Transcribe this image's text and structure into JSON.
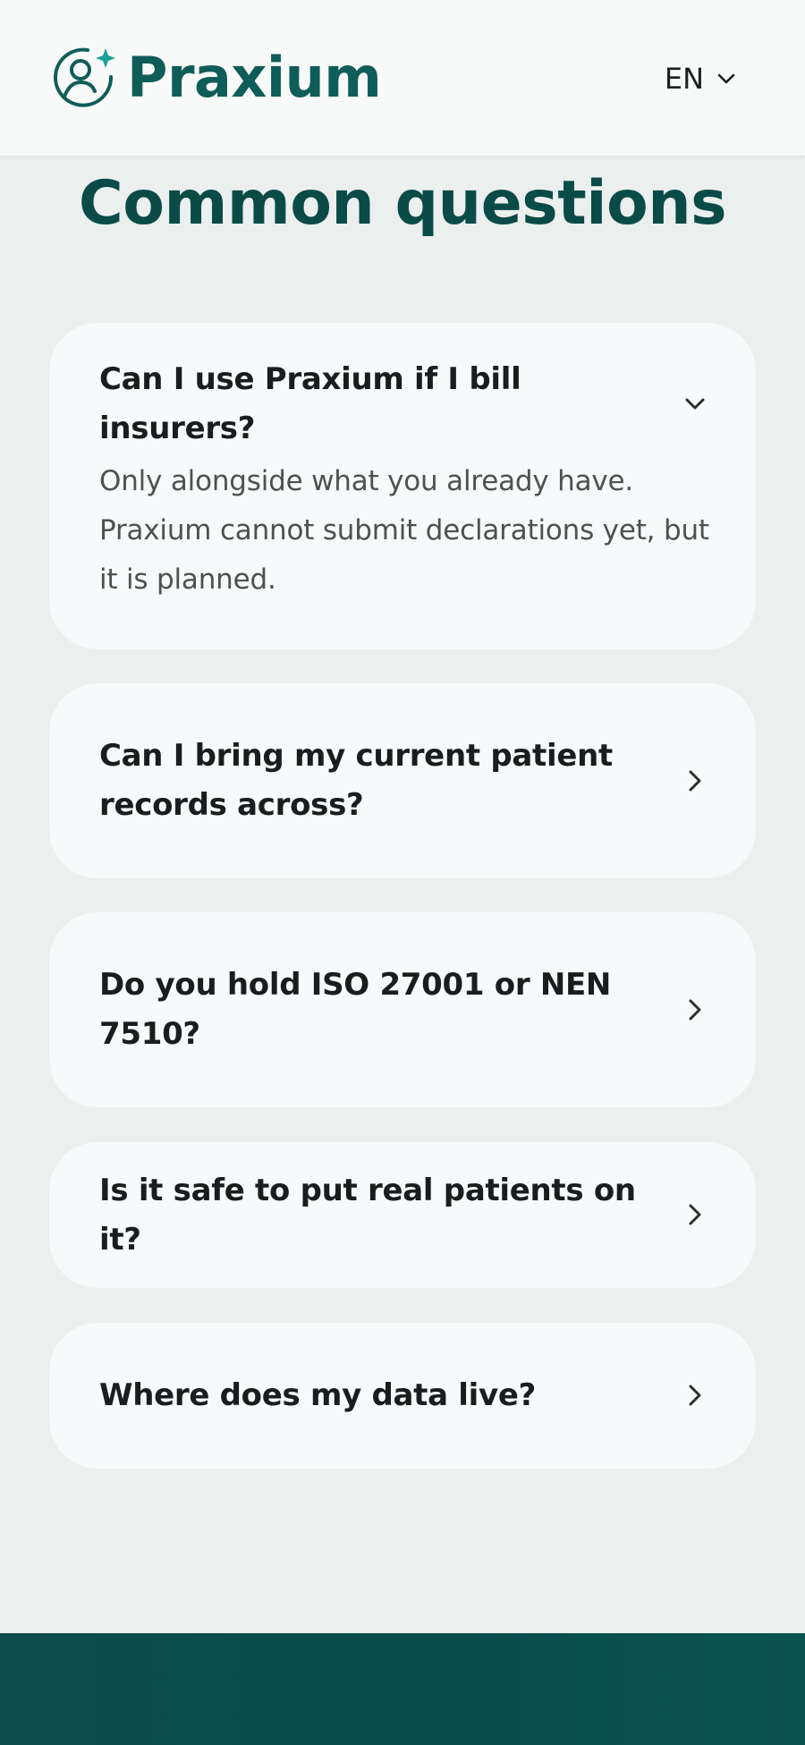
{
  "header": {
    "brand_name": "Praxium",
    "language": "EN"
  },
  "faq": {
    "title": "Common questions",
    "items": [
      {
        "question": "Can I use Praxium if I bill insurers?",
        "answer": "Only alongside what you already have. Praxium cannot submit declarations yet, but it is planned.",
        "expanded": true
      },
      {
        "question": "Can I bring my current patient records across?",
        "expanded": false
      },
      {
        "question": "Do you hold ISO 27001 or NEN 7510?",
        "expanded": false
      },
      {
        "question": "Is it safe to put real patients on it?",
        "expanded": false
      },
      {
        "question": "Where does my data live?",
        "expanded": false
      }
    ]
  },
  "colors": {
    "brand": "#0f5d58",
    "title": "#0a4b47",
    "page_background": "#ebefee",
    "card_background": "#f7f9fa",
    "footer": "#074e4d"
  },
  "icons": {
    "logo": "user-sparkle-icon",
    "expanded": "chevron-down-icon",
    "collapsed": "chevron-right-icon",
    "language": "chevron-down-icon"
  }
}
